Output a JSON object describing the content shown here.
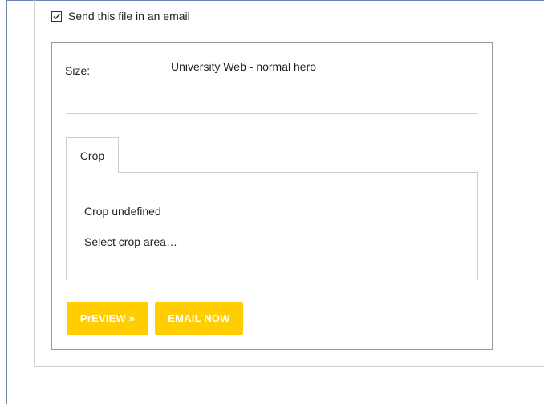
{
  "email_option": {
    "label": "Send this file in an email",
    "checked": true
  },
  "size": {
    "label": "Size:",
    "value": "University Web - normal hero"
  },
  "tabs": [
    {
      "label": "Crop",
      "active": true
    }
  ],
  "crop": {
    "status": "Crop undefined",
    "select_link": "Select crop area…"
  },
  "buttons": {
    "preview": "PrEVIEW »",
    "email_now": "EMAIL NOW"
  },
  "colors": {
    "button_bg": "#ffcd00",
    "button_text": "#ffffff",
    "frame_border": "#6b86b3"
  }
}
